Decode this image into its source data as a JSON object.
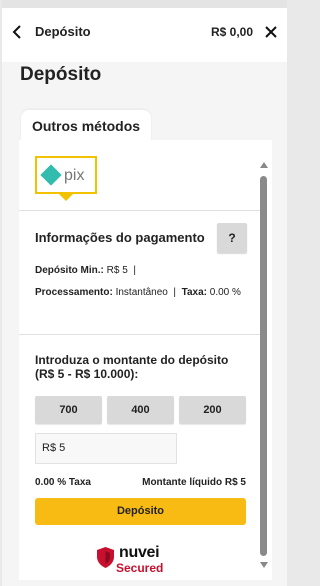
{
  "header": {
    "title": "Depósito",
    "balance": "R$ 0,00",
    "icons": [
      "arrow-left-icon",
      "close-icon"
    ]
  },
  "page": {
    "title": "Depósito",
    "tab_label": "Outros métodos"
  },
  "method": {
    "name": "pix",
    "brand_color": "#f2c200"
  },
  "payment_info": {
    "title": "Informações do pagamento",
    "help_label": "?",
    "min_label": "Depósito Min.:",
    "min_value": "R$ 5",
    "min_sep": "|",
    "processing_label": "Processamento:",
    "processing_value": "Instantâneo",
    "processing_sep": "|",
    "fee_label": "Taxa:",
    "fee_value": "0.00 %"
  },
  "amount": {
    "title_line1": "Introduza o montante do depósito",
    "title_line2": "(R$ 5 - R$ 10.000):",
    "quick_amounts": [
      "700",
      "400",
      "200"
    ],
    "input_value": "R$ 5",
    "fee_text": "0.00 % Taxa",
    "net_text": "Montante líquido R$ 5",
    "submit_label": "Depósito",
    "accent_color": "#f8bb14"
  },
  "footer": {
    "brand": "nuvei",
    "secured": "Secured",
    "brand_color": "#c8102e"
  }
}
